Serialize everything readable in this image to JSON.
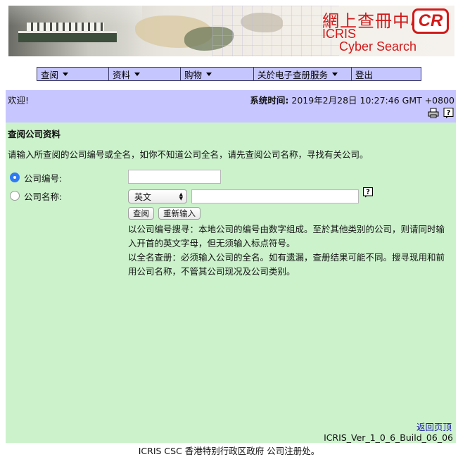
{
  "banner": {
    "title_cn": "網上查冊中心",
    "title_en_1": "ICRIS",
    "title_en_2": "Cyber Search Centre",
    "logo_text": "CR"
  },
  "menu": {
    "items": [
      {
        "label": "查阅",
        "has_dropdown": true
      },
      {
        "label": "资料",
        "has_dropdown": true
      },
      {
        "label": "购物",
        "has_dropdown": true
      },
      {
        "label": "关於电子查册服务",
        "has_dropdown": true
      },
      {
        "label": "登出",
        "has_dropdown": false
      }
    ]
  },
  "welcome": {
    "greeting": "欢迎!",
    "systime_label": "系统时间:",
    "systime_value": "2019年2月28日 10:27:46 GMT +0800",
    "icons": [
      "printer-icon",
      "help-icon"
    ]
  },
  "form": {
    "section_title": "查阅公司资料",
    "instruction": "请输入所查阅的公司编号或全名，如你不知道公司全名，请先查阅公司名称，寻找有关公司。",
    "company_number": {
      "label": "公司编号:",
      "value": "",
      "selected": true
    },
    "company_name": {
      "label": "公司名称:",
      "value": "",
      "selected": false,
      "language_selected": "英文"
    },
    "search_button": "查阅",
    "reset_button": "重新输入",
    "note_1": "以公司编号搜寻：本地公司的编号由数字组成。至於其他类别的公司，则请同时输入开首的英文字母，但无须输入标点符号。",
    "note_2": "以全名查册：必须输入公司的全名。如有遗漏，查册结果可能不同。搜寻现用和前用公司名称，不管其公司现况及公司类别。"
  },
  "footer": {
    "back_to_top": "返回页顶",
    "version": "ICRIS_Ver_1_0_6_Build_06_06",
    "copyright": "ICRIS CSC 香港特别行政区政府 公司注册处。"
  },
  "colors": {
    "menu_bg": "#c6c6ff",
    "welcome_bg": "#c8c6ff",
    "content_bg": "#ccf2cc",
    "brand_red": "#d21a1a",
    "link_blue": "#1a1aa8",
    "radio_selected": "#2f7bf5"
  }
}
